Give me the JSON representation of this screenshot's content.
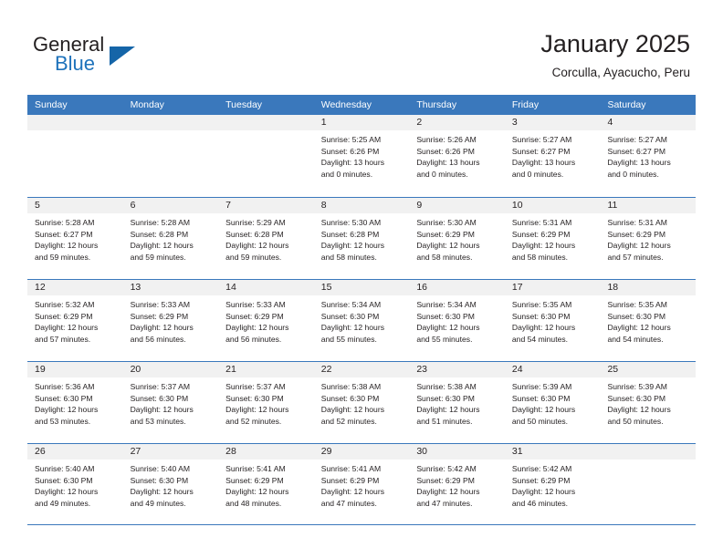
{
  "brand": {
    "name_line1": "General",
    "name_line2": "Blue",
    "flag_icon": "triangle-flag-icon",
    "accent_color": "#1e72bb"
  },
  "header": {
    "month_title": "January 2025",
    "location": "Corculla, Ayacucho, Peru"
  },
  "calendar": {
    "header_color": "#3a78bc",
    "daynum_bg": "#f1f1f1",
    "day_names": [
      "Sunday",
      "Monday",
      "Tuesday",
      "Wednesday",
      "Thursday",
      "Friday",
      "Saturday"
    ],
    "weeks": [
      [
        {
          "day": "",
          "sunrise": "",
          "sunset": "",
          "daylight_line1": "",
          "daylight_line2": ""
        },
        {
          "day": "",
          "sunrise": "",
          "sunset": "",
          "daylight_line1": "",
          "daylight_line2": ""
        },
        {
          "day": "",
          "sunrise": "",
          "sunset": "",
          "daylight_line1": "",
          "daylight_line2": ""
        },
        {
          "day": "1",
          "sunrise": "Sunrise: 5:25 AM",
          "sunset": "Sunset: 6:26 PM",
          "daylight_line1": "Daylight: 13 hours",
          "daylight_line2": "and 0 minutes."
        },
        {
          "day": "2",
          "sunrise": "Sunrise: 5:26 AM",
          "sunset": "Sunset: 6:26 PM",
          "daylight_line1": "Daylight: 13 hours",
          "daylight_line2": "and 0 minutes."
        },
        {
          "day": "3",
          "sunrise": "Sunrise: 5:27 AM",
          "sunset": "Sunset: 6:27 PM",
          "daylight_line1": "Daylight: 13 hours",
          "daylight_line2": "and 0 minutes."
        },
        {
          "day": "4",
          "sunrise": "Sunrise: 5:27 AM",
          "sunset": "Sunset: 6:27 PM",
          "daylight_line1": "Daylight: 13 hours",
          "daylight_line2": "and 0 minutes."
        }
      ],
      [
        {
          "day": "5",
          "sunrise": "Sunrise: 5:28 AM",
          "sunset": "Sunset: 6:27 PM",
          "daylight_line1": "Daylight: 12 hours",
          "daylight_line2": "and 59 minutes."
        },
        {
          "day": "6",
          "sunrise": "Sunrise: 5:28 AM",
          "sunset": "Sunset: 6:28 PM",
          "daylight_line1": "Daylight: 12 hours",
          "daylight_line2": "and 59 minutes."
        },
        {
          "day": "7",
          "sunrise": "Sunrise: 5:29 AM",
          "sunset": "Sunset: 6:28 PM",
          "daylight_line1": "Daylight: 12 hours",
          "daylight_line2": "and 59 minutes."
        },
        {
          "day": "8",
          "sunrise": "Sunrise: 5:30 AM",
          "sunset": "Sunset: 6:28 PM",
          "daylight_line1": "Daylight: 12 hours",
          "daylight_line2": "and 58 minutes."
        },
        {
          "day": "9",
          "sunrise": "Sunrise: 5:30 AM",
          "sunset": "Sunset: 6:29 PM",
          "daylight_line1": "Daylight: 12 hours",
          "daylight_line2": "and 58 minutes."
        },
        {
          "day": "10",
          "sunrise": "Sunrise: 5:31 AM",
          "sunset": "Sunset: 6:29 PM",
          "daylight_line1": "Daylight: 12 hours",
          "daylight_line2": "and 58 minutes."
        },
        {
          "day": "11",
          "sunrise": "Sunrise: 5:31 AM",
          "sunset": "Sunset: 6:29 PM",
          "daylight_line1": "Daylight: 12 hours",
          "daylight_line2": "and 57 minutes."
        }
      ],
      [
        {
          "day": "12",
          "sunrise": "Sunrise: 5:32 AM",
          "sunset": "Sunset: 6:29 PM",
          "daylight_line1": "Daylight: 12 hours",
          "daylight_line2": "and 57 minutes."
        },
        {
          "day": "13",
          "sunrise": "Sunrise: 5:33 AM",
          "sunset": "Sunset: 6:29 PM",
          "daylight_line1": "Daylight: 12 hours",
          "daylight_line2": "and 56 minutes."
        },
        {
          "day": "14",
          "sunrise": "Sunrise: 5:33 AM",
          "sunset": "Sunset: 6:29 PM",
          "daylight_line1": "Daylight: 12 hours",
          "daylight_line2": "and 56 minutes."
        },
        {
          "day": "15",
          "sunrise": "Sunrise: 5:34 AM",
          "sunset": "Sunset: 6:30 PM",
          "daylight_line1": "Daylight: 12 hours",
          "daylight_line2": "and 55 minutes."
        },
        {
          "day": "16",
          "sunrise": "Sunrise: 5:34 AM",
          "sunset": "Sunset: 6:30 PM",
          "daylight_line1": "Daylight: 12 hours",
          "daylight_line2": "and 55 minutes."
        },
        {
          "day": "17",
          "sunrise": "Sunrise: 5:35 AM",
          "sunset": "Sunset: 6:30 PM",
          "daylight_line1": "Daylight: 12 hours",
          "daylight_line2": "and 54 minutes."
        },
        {
          "day": "18",
          "sunrise": "Sunrise: 5:35 AM",
          "sunset": "Sunset: 6:30 PM",
          "daylight_line1": "Daylight: 12 hours",
          "daylight_line2": "and 54 minutes."
        }
      ],
      [
        {
          "day": "19",
          "sunrise": "Sunrise: 5:36 AM",
          "sunset": "Sunset: 6:30 PM",
          "daylight_line1": "Daylight: 12 hours",
          "daylight_line2": "and 53 minutes."
        },
        {
          "day": "20",
          "sunrise": "Sunrise: 5:37 AM",
          "sunset": "Sunset: 6:30 PM",
          "daylight_line1": "Daylight: 12 hours",
          "daylight_line2": "and 53 minutes."
        },
        {
          "day": "21",
          "sunrise": "Sunrise: 5:37 AM",
          "sunset": "Sunset: 6:30 PM",
          "daylight_line1": "Daylight: 12 hours",
          "daylight_line2": "and 52 minutes."
        },
        {
          "day": "22",
          "sunrise": "Sunrise: 5:38 AM",
          "sunset": "Sunset: 6:30 PM",
          "daylight_line1": "Daylight: 12 hours",
          "daylight_line2": "and 52 minutes."
        },
        {
          "day": "23",
          "sunrise": "Sunrise: 5:38 AM",
          "sunset": "Sunset: 6:30 PM",
          "daylight_line1": "Daylight: 12 hours",
          "daylight_line2": "and 51 minutes."
        },
        {
          "day": "24",
          "sunrise": "Sunrise: 5:39 AM",
          "sunset": "Sunset: 6:30 PM",
          "daylight_line1": "Daylight: 12 hours",
          "daylight_line2": "and 50 minutes."
        },
        {
          "day": "25",
          "sunrise": "Sunrise: 5:39 AM",
          "sunset": "Sunset: 6:30 PM",
          "daylight_line1": "Daylight: 12 hours",
          "daylight_line2": "and 50 minutes."
        }
      ],
      [
        {
          "day": "26",
          "sunrise": "Sunrise: 5:40 AM",
          "sunset": "Sunset: 6:30 PM",
          "daylight_line1": "Daylight: 12 hours",
          "daylight_line2": "and 49 minutes."
        },
        {
          "day": "27",
          "sunrise": "Sunrise: 5:40 AM",
          "sunset": "Sunset: 6:30 PM",
          "daylight_line1": "Daylight: 12 hours",
          "daylight_line2": "and 49 minutes."
        },
        {
          "day": "28",
          "sunrise": "Sunrise: 5:41 AM",
          "sunset": "Sunset: 6:29 PM",
          "daylight_line1": "Daylight: 12 hours",
          "daylight_line2": "and 48 minutes."
        },
        {
          "day": "29",
          "sunrise": "Sunrise: 5:41 AM",
          "sunset": "Sunset: 6:29 PM",
          "daylight_line1": "Daylight: 12 hours",
          "daylight_line2": "and 47 minutes."
        },
        {
          "day": "30",
          "sunrise": "Sunrise: 5:42 AM",
          "sunset": "Sunset: 6:29 PM",
          "daylight_line1": "Daylight: 12 hours",
          "daylight_line2": "and 47 minutes."
        },
        {
          "day": "31",
          "sunrise": "Sunrise: 5:42 AM",
          "sunset": "Sunset: 6:29 PM",
          "daylight_line1": "Daylight: 12 hours",
          "daylight_line2": "and 46 minutes."
        },
        {
          "day": "",
          "sunrise": "",
          "sunset": "",
          "daylight_line1": "",
          "daylight_line2": ""
        }
      ]
    ]
  }
}
